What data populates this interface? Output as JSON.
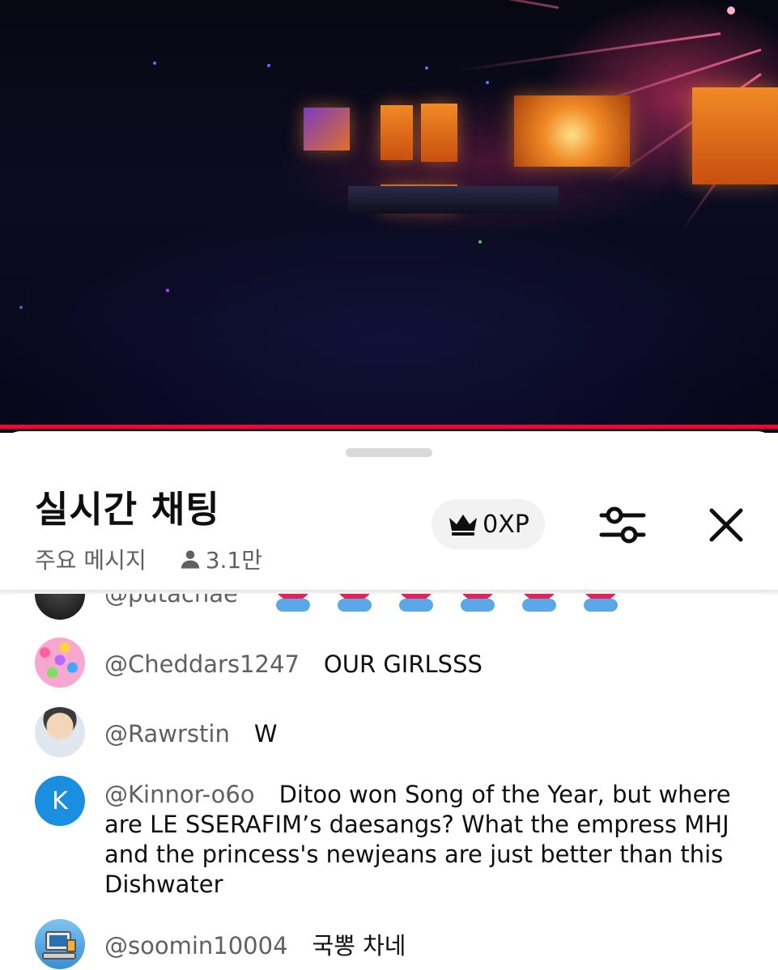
{
  "header": {
    "title": "실시간 채팅",
    "mode": "주요 메시지",
    "viewers": "3.1만",
    "xp": "0XP"
  },
  "messages": [
    {
      "author": "@putachae",
      "text": "",
      "avatar": "dark-photo"
    },
    {
      "author": "@Cheddars1247",
      "text": "OUR GIRLSSS",
      "avatar": "colorful-pattern"
    },
    {
      "author": "@Rawrstin",
      "text": "W",
      "avatar": "anime-character"
    },
    {
      "author": "@Kinnor-o6o",
      "text": "Ditoo won Song of the Year, but where are LE SSERAFIM’s daesangs? What the empress MHJ and the princess's newjeans are just better than this Dishwater",
      "avatar": "K",
      "avatar_color": "#1a8fe0"
    },
    {
      "author": "@soomin10004",
      "text": "국뽕 차네",
      "avatar": "computer-illustration"
    }
  ],
  "colors": {
    "progress": "#ff0033",
    "author": "#606060",
    "chip": "#f2f2f2"
  }
}
